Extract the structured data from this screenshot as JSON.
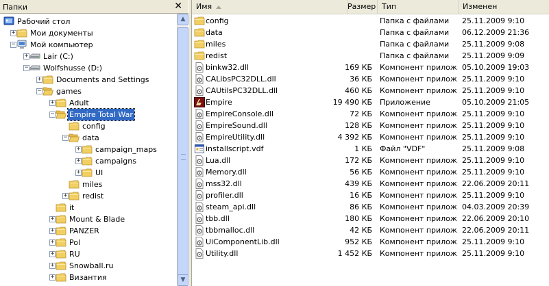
{
  "folders_pane": {
    "title": "Папки",
    "close_glyph": "✕",
    "tree": [
      {
        "label": "Рабочий стол",
        "icon": "desktop-icon",
        "level": 0,
        "expander": ""
      },
      {
        "label": "Мои документы",
        "icon": "documents-folder-icon",
        "level": 1,
        "expander": "+"
      },
      {
        "label": "Мой компьютер",
        "icon": "computer-icon",
        "level": 1,
        "expander": "−"
      },
      {
        "label": "Lair (C:)",
        "icon": "drive-icon",
        "level": 2,
        "expander": "+"
      },
      {
        "label": "Wolfshusse (D:)",
        "icon": "drive-icon",
        "level": 2,
        "expander": "−"
      },
      {
        "label": "Documents and Settings",
        "icon": "folder-icon",
        "level": 3,
        "expander": "+"
      },
      {
        "label": "games",
        "icon": "open-folder-icon",
        "level": 3,
        "expander": "−"
      },
      {
        "label": "Adult",
        "icon": "folder-icon",
        "level": 4,
        "expander": "+"
      },
      {
        "label": "Empire Total War",
        "icon": "open-folder-icon",
        "level": 4,
        "expander": "−",
        "selected": true
      },
      {
        "label": "config",
        "icon": "folder-icon",
        "level": 5,
        "expander": ""
      },
      {
        "label": "data",
        "icon": "open-folder-icon",
        "level": 5,
        "expander": "−"
      },
      {
        "label": "campaign_maps",
        "icon": "folder-icon",
        "level": 6,
        "expander": "+"
      },
      {
        "label": "campaigns",
        "icon": "folder-icon",
        "level": 6,
        "expander": "+"
      },
      {
        "label": "UI",
        "icon": "folder-icon",
        "level": 6,
        "expander": "+"
      },
      {
        "label": "miles",
        "icon": "folder-icon",
        "level": 5,
        "expander": ""
      },
      {
        "label": "redist",
        "icon": "folder-icon",
        "level": 5,
        "expander": "+"
      },
      {
        "label": "it",
        "icon": "folder-icon",
        "level": 4,
        "expander": ""
      },
      {
        "label": "Mount & Blade",
        "icon": "folder-icon",
        "level": 4,
        "expander": "+"
      },
      {
        "label": "PANZER",
        "icon": "folder-icon",
        "level": 4,
        "expander": "+"
      },
      {
        "label": "Pol",
        "icon": "folder-icon",
        "level": 4,
        "expander": "+"
      },
      {
        "label": "RU",
        "icon": "folder-icon",
        "level": 4,
        "expander": "+"
      },
      {
        "label": "Snowball.ru",
        "icon": "folder-icon",
        "level": 4,
        "expander": "+"
      },
      {
        "label": "Византия",
        "icon": "folder-icon",
        "level": 4,
        "expander": "+"
      }
    ]
  },
  "list_pane": {
    "columns": {
      "name": "Имя",
      "size": "Размер",
      "type": "Тип",
      "modified": "Изменен"
    },
    "files": [
      {
        "name": "config",
        "size": "",
        "type": "Папка с файлами",
        "modified": "25.11.2009 9:10",
        "icon": "folder-icon"
      },
      {
        "name": "data",
        "size": "",
        "type": "Папка с файлами",
        "modified": "06.12.2009 21:36",
        "icon": "folder-icon"
      },
      {
        "name": "miles",
        "size": "",
        "type": "Папка с файлами",
        "modified": "25.11.2009 9:08",
        "icon": "folder-icon"
      },
      {
        "name": "redist",
        "size": "",
        "type": "Папка с файлами",
        "modified": "25.11.2009 9:09",
        "icon": "folder-icon"
      },
      {
        "name": "binkw32.dll",
        "size": "169 КБ",
        "type": "Компонент прилож...",
        "modified": "05.10.2009 19:03",
        "icon": "dll-icon"
      },
      {
        "name": "CALibsPC32DLL.dll",
        "size": "36 КБ",
        "type": "Компонент прилож...",
        "modified": "25.11.2009 9:10",
        "icon": "dll-icon"
      },
      {
        "name": "CAUtilsPC32DLL.dll",
        "size": "460 КБ",
        "type": "Компонент прилож...",
        "modified": "25.11.2009 9:10",
        "icon": "dll-icon"
      },
      {
        "name": "Empire",
        "size": "19 490 КБ",
        "type": "Приложение",
        "modified": "05.10.2009 21:05",
        "icon": "empire-app-icon"
      },
      {
        "name": "EmpireConsole.dll",
        "size": "72 КБ",
        "type": "Компонент прилож...",
        "modified": "25.11.2009 9:10",
        "icon": "dll-icon"
      },
      {
        "name": "EmpireSound.dll",
        "size": "128 КБ",
        "type": "Компонент прилож...",
        "modified": "25.11.2009 9:10",
        "icon": "dll-icon"
      },
      {
        "name": "EmpireUtility.dll",
        "size": "4 392 КБ",
        "type": "Компонент прилож...",
        "modified": "25.11.2009 9:10",
        "icon": "dll-icon"
      },
      {
        "name": "installscript.vdf",
        "size": "1 КБ",
        "type": "Файл \"VDF\"",
        "modified": "25.11.2009 9:08",
        "icon": "vdf-file-icon"
      },
      {
        "name": "Lua.dll",
        "size": "172 КБ",
        "type": "Компонент прилож...",
        "modified": "25.11.2009 9:10",
        "icon": "dll-icon"
      },
      {
        "name": "Memory.dll",
        "size": "56 КБ",
        "type": "Компонент прилож...",
        "modified": "25.11.2009 9:10",
        "icon": "dll-icon"
      },
      {
        "name": "mss32.dll",
        "size": "439 КБ",
        "type": "Компонент прилож...",
        "modified": "22.06.2009 20:11",
        "icon": "dll-icon"
      },
      {
        "name": "profiler.dll",
        "size": "16 КБ",
        "type": "Компонент прилож...",
        "modified": "25.11.2009 9:10",
        "icon": "dll-icon"
      },
      {
        "name": "steam_api.dll",
        "size": "86 КБ",
        "type": "Компонент прилож...",
        "modified": "04.03.2009 20:39",
        "icon": "dll-icon"
      },
      {
        "name": "tbb.dll",
        "size": "180 КБ",
        "type": "Компонент прилож...",
        "modified": "22.06.2009 20:10",
        "icon": "dll-icon"
      },
      {
        "name": "tbbmalloc.dll",
        "size": "42 КБ",
        "type": "Компонент прилож...",
        "modified": "22.06.2009 20:11",
        "icon": "dll-icon"
      },
      {
        "name": "UiComponentLib.dll",
        "size": "952 КБ",
        "type": "Компонент прилож...",
        "modified": "25.11.2009 9:10",
        "icon": "dll-icon"
      },
      {
        "name": "Utility.dll",
        "size": "1 452 КБ",
        "type": "Компонент прилож...",
        "modified": "25.11.2009 9:10",
        "icon": "dll-icon"
      }
    ]
  },
  "colors": {
    "selection": "#316ac5",
    "folder": "#f2cf62",
    "header": "#ebeadb"
  }
}
